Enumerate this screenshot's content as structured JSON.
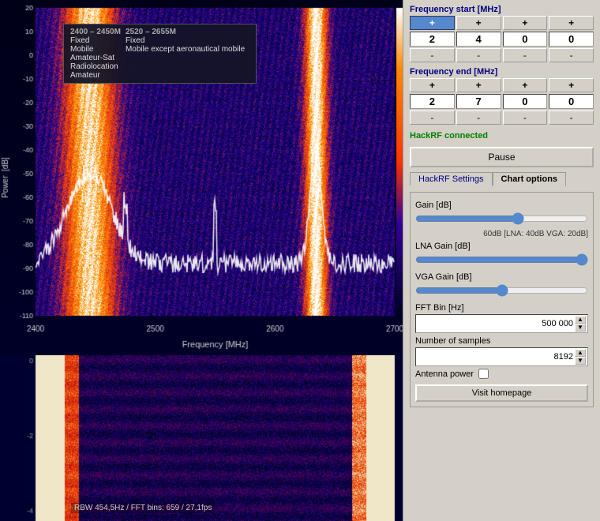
{
  "left": {
    "tooltip": {
      "col1_range": "2400 – 2450M",
      "col2_range": "2520 – 2655M",
      "row1": [
        "Fixed",
        "Fixed"
      ],
      "row2": [
        "Mobile",
        "Mobile except aeronautical mobile"
      ],
      "row3": [
        "Amateur-Sat",
        ""
      ],
      "row4": [
        "Radiolocation",
        ""
      ],
      "row5": [
        "Amateur",
        ""
      ]
    },
    "x_labels": [
      "2400",
      "2500",
      "2600",
      "2700"
    ],
    "y_labels": [
      "20",
      "10",
      "0",
      "-10",
      "-20",
      "-30",
      "-40",
      "-50",
      "-60",
      "-70",
      "-80",
      "-90",
      "-100",
      "-110"
    ],
    "x_axis_label": "Frequency [MHz]",
    "y_axis_label": "Power  [dB]",
    "rbw_label": "RBW 454,5Hz / FFT bins: 659 / 27,1fps"
  },
  "right": {
    "freq_start_label": "Frequency start [MHz]",
    "freq_start_digits": [
      "2",
      "4",
      "0",
      "0"
    ],
    "freq_end_label": "Frequency end [MHz]",
    "freq_end_digits": [
      "2",
      "7",
      "0",
      "0"
    ],
    "status_label": "HackRF connected",
    "pause_label": "Pause",
    "tabs": [
      {
        "id": "hackrf",
        "label": "HackRF Settings",
        "active": false
      },
      {
        "id": "chart",
        "label": "Chart options",
        "active": true
      }
    ],
    "gain_label": "Gain [dB]",
    "gain_value": "60dB  [LNA: 40dB  VGA: 20dB]",
    "gain_slider": 60,
    "lna_label": "LNA Gain [dB]",
    "lna_slider": 100,
    "vga_label": "VGA Gain [dB]",
    "vga_slider": 50,
    "fft_bin_label": "FFT Bin [Hz]",
    "fft_bin_value": "500 000",
    "num_samples_label": "Number of samples",
    "num_samples_value": "8192",
    "antenna_label": "Antenna power",
    "homepage_label": "Visit homepage"
  }
}
